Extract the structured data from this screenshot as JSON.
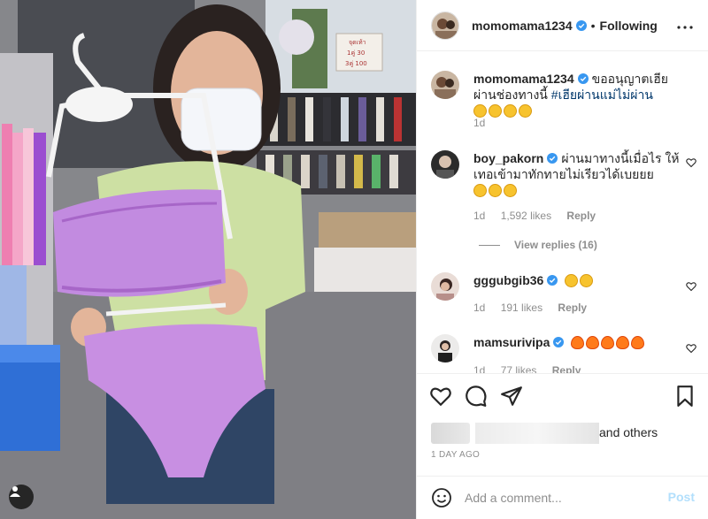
{
  "post": {
    "author": "momomama1234",
    "follow_status": "Following",
    "caption_text": "ขออนุญาตเฮียผ่านช่องทางนี้",
    "caption_hashtag": "#เฮียผ่านแม่ไม่ผ่าน",
    "caption_time": "1d",
    "sign_text": "จุดเท้า\n1คู่ 30\n3คู่ 100"
  },
  "comments": [
    {
      "username": "boy_pakorn",
      "text": "ผ่านมาทางนี้เมื่อไร ให้เทอเข้ามาทักทายไม่เรียวได้เบยยย",
      "time": "1d",
      "likes": "1,592 likes",
      "reply_label": "Reply",
      "view_replies": "View replies (16)"
    },
    {
      "username": "gggubgib36",
      "text": "",
      "time": "1d",
      "likes": "191 likes",
      "reply_label": "Reply"
    },
    {
      "username": "mamsurivipa",
      "text": "",
      "time": "1d",
      "likes": "77 likes",
      "reply_label": "Reply"
    }
  ],
  "likes_line": "and others",
  "post_date": "1 DAY AGO",
  "composer": {
    "placeholder": "Add a comment...",
    "post_label": "Post"
  },
  "icons": {
    "verified": "verified-badge-icon",
    "more": "more-options-icon",
    "like": "heart-icon",
    "comment": "comment-icon",
    "share": "share-icon",
    "save": "bookmark-icon",
    "emoji": "emoji-icon",
    "user_tag": "user-tag-icon"
  },
  "colors": {
    "verified_blue": "#3897f0",
    "hashtag": "#00376b",
    "post_button_disabled": "#b2dffc",
    "muted_text": "#8e8e8e"
  }
}
